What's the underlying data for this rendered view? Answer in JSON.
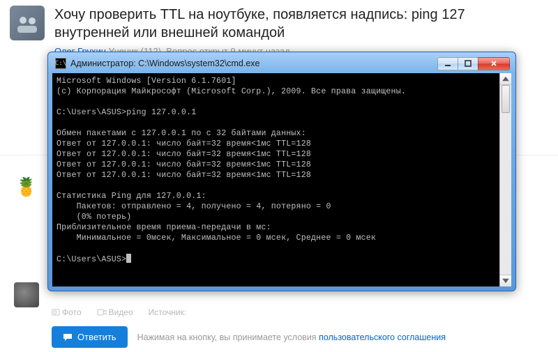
{
  "question": {
    "title_line1": "Хочу проверить TTL на ноутбуке, появляется надпись: ping 127",
    "title_line2": "внутренней или внешней командой",
    "author_name": "Олег Грухин",
    "author_rank": "Ученик (112),",
    "ago": "Вопрос открыт 9 минут назад"
  },
  "cmd": {
    "window_title": "Администратор: C:\\Windows\\system32\\cmd.exe",
    "lines": [
      "Microsoft Windows [Version 6.1.7601]",
      "(c) Корпорация Майкрософт (Microsoft Corp.), 2009. Все права защищены.",
      "",
      "C:\\Users\\ASUS>ping 127.0.0.1",
      "",
      "Обмен пакетами с 127.0.0.1 по с 32 байтами данных:",
      "Ответ от 127.0.0.1: число байт=32 время<1мс TTL=128",
      "Ответ от 127.0.0.1: число байт=32 время<1мс TTL=128",
      "Ответ от 127.0.0.1: число байт=32 время<1мс TTL=128",
      "Ответ от 127.0.0.1: число байт=32 время<1мс TTL=128",
      "",
      "Статистика Ping для 127.0.0.1:",
      "    Пакетов: отправлено = 4, получено = 4, потеряно = 0",
      "    (0% потерь)",
      "Приблизительное время приема-передачи в мс:",
      "    Минимальное = 0мсек, Максимальное = 0 мсек, Среднее = 0 мсек",
      "",
      "C:\\Users\\ASUS>"
    ]
  },
  "attach": {
    "photo": "Фото",
    "video": "Видео",
    "source": "Источник:"
  },
  "answer": {
    "button": "Ответить",
    "terms_prefix": "Нажимая на кнопку, вы принимаете условия ",
    "terms_link": "пользовательского соглашения"
  },
  "icons": {
    "pineapple": "🍍"
  }
}
